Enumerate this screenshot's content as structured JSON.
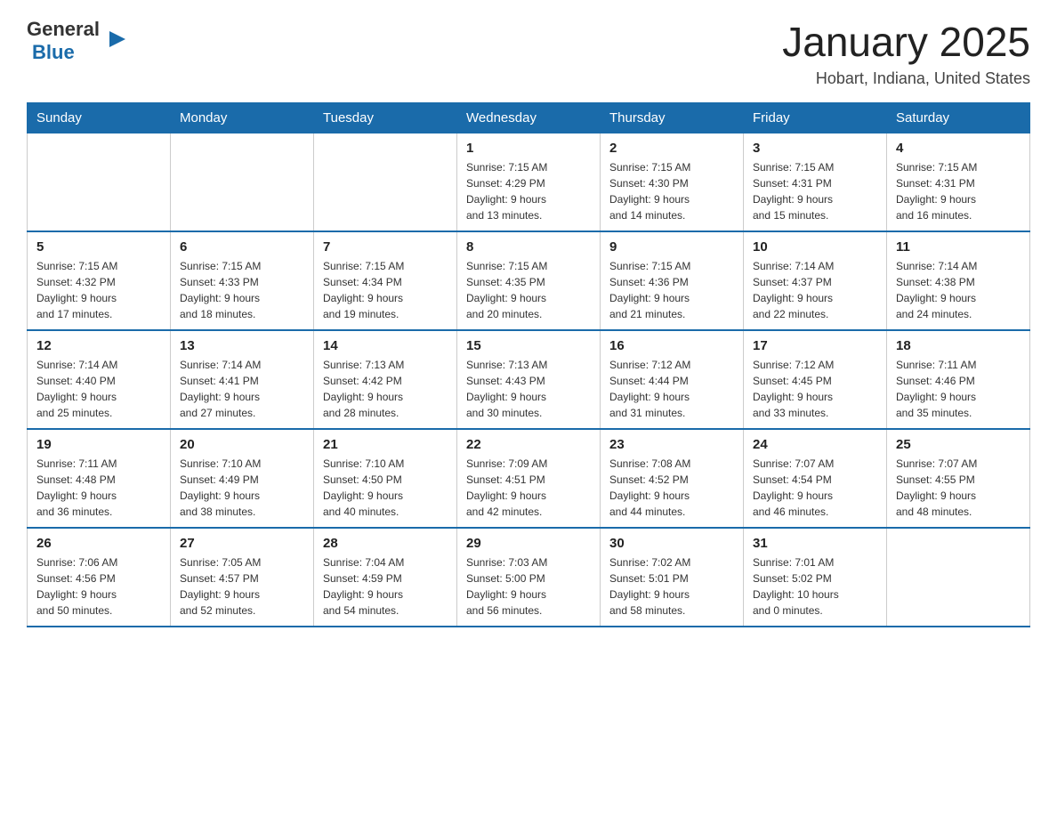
{
  "header": {
    "logo": {
      "general": "General",
      "blue": "Blue"
    },
    "title": "January 2025",
    "subtitle": "Hobart, Indiana, United States"
  },
  "weekdays": [
    "Sunday",
    "Monday",
    "Tuesday",
    "Wednesday",
    "Thursday",
    "Friday",
    "Saturday"
  ],
  "weeks": [
    [
      {
        "day": "",
        "info": ""
      },
      {
        "day": "",
        "info": ""
      },
      {
        "day": "",
        "info": ""
      },
      {
        "day": "1",
        "info": "Sunrise: 7:15 AM\nSunset: 4:29 PM\nDaylight: 9 hours\nand 13 minutes."
      },
      {
        "day": "2",
        "info": "Sunrise: 7:15 AM\nSunset: 4:30 PM\nDaylight: 9 hours\nand 14 minutes."
      },
      {
        "day": "3",
        "info": "Sunrise: 7:15 AM\nSunset: 4:31 PM\nDaylight: 9 hours\nand 15 minutes."
      },
      {
        "day": "4",
        "info": "Sunrise: 7:15 AM\nSunset: 4:31 PM\nDaylight: 9 hours\nand 16 minutes."
      }
    ],
    [
      {
        "day": "5",
        "info": "Sunrise: 7:15 AM\nSunset: 4:32 PM\nDaylight: 9 hours\nand 17 minutes."
      },
      {
        "day": "6",
        "info": "Sunrise: 7:15 AM\nSunset: 4:33 PM\nDaylight: 9 hours\nand 18 minutes."
      },
      {
        "day": "7",
        "info": "Sunrise: 7:15 AM\nSunset: 4:34 PM\nDaylight: 9 hours\nand 19 minutes."
      },
      {
        "day": "8",
        "info": "Sunrise: 7:15 AM\nSunset: 4:35 PM\nDaylight: 9 hours\nand 20 minutes."
      },
      {
        "day": "9",
        "info": "Sunrise: 7:15 AM\nSunset: 4:36 PM\nDaylight: 9 hours\nand 21 minutes."
      },
      {
        "day": "10",
        "info": "Sunrise: 7:14 AM\nSunset: 4:37 PM\nDaylight: 9 hours\nand 22 minutes."
      },
      {
        "day": "11",
        "info": "Sunrise: 7:14 AM\nSunset: 4:38 PM\nDaylight: 9 hours\nand 24 minutes."
      }
    ],
    [
      {
        "day": "12",
        "info": "Sunrise: 7:14 AM\nSunset: 4:40 PM\nDaylight: 9 hours\nand 25 minutes."
      },
      {
        "day": "13",
        "info": "Sunrise: 7:14 AM\nSunset: 4:41 PM\nDaylight: 9 hours\nand 27 minutes."
      },
      {
        "day": "14",
        "info": "Sunrise: 7:13 AM\nSunset: 4:42 PM\nDaylight: 9 hours\nand 28 minutes."
      },
      {
        "day": "15",
        "info": "Sunrise: 7:13 AM\nSunset: 4:43 PM\nDaylight: 9 hours\nand 30 minutes."
      },
      {
        "day": "16",
        "info": "Sunrise: 7:12 AM\nSunset: 4:44 PM\nDaylight: 9 hours\nand 31 minutes."
      },
      {
        "day": "17",
        "info": "Sunrise: 7:12 AM\nSunset: 4:45 PM\nDaylight: 9 hours\nand 33 minutes."
      },
      {
        "day": "18",
        "info": "Sunrise: 7:11 AM\nSunset: 4:46 PM\nDaylight: 9 hours\nand 35 minutes."
      }
    ],
    [
      {
        "day": "19",
        "info": "Sunrise: 7:11 AM\nSunset: 4:48 PM\nDaylight: 9 hours\nand 36 minutes."
      },
      {
        "day": "20",
        "info": "Sunrise: 7:10 AM\nSunset: 4:49 PM\nDaylight: 9 hours\nand 38 minutes."
      },
      {
        "day": "21",
        "info": "Sunrise: 7:10 AM\nSunset: 4:50 PM\nDaylight: 9 hours\nand 40 minutes."
      },
      {
        "day": "22",
        "info": "Sunrise: 7:09 AM\nSunset: 4:51 PM\nDaylight: 9 hours\nand 42 minutes."
      },
      {
        "day": "23",
        "info": "Sunrise: 7:08 AM\nSunset: 4:52 PM\nDaylight: 9 hours\nand 44 minutes."
      },
      {
        "day": "24",
        "info": "Sunrise: 7:07 AM\nSunset: 4:54 PM\nDaylight: 9 hours\nand 46 minutes."
      },
      {
        "day": "25",
        "info": "Sunrise: 7:07 AM\nSunset: 4:55 PM\nDaylight: 9 hours\nand 48 minutes."
      }
    ],
    [
      {
        "day": "26",
        "info": "Sunrise: 7:06 AM\nSunset: 4:56 PM\nDaylight: 9 hours\nand 50 minutes."
      },
      {
        "day": "27",
        "info": "Sunrise: 7:05 AM\nSunset: 4:57 PM\nDaylight: 9 hours\nand 52 minutes."
      },
      {
        "day": "28",
        "info": "Sunrise: 7:04 AM\nSunset: 4:59 PM\nDaylight: 9 hours\nand 54 minutes."
      },
      {
        "day": "29",
        "info": "Sunrise: 7:03 AM\nSunset: 5:00 PM\nDaylight: 9 hours\nand 56 minutes."
      },
      {
        "day": "30",
        "info": "Sunrise: 7:02 AM\nSunset: 5:01 PM\nDaylight: 9 hours\nand 58 minutes."
      },
      {
        "day": "31",
        "info": "Sunrise: 7:01 AM\nSunset: 5:02 PM\nDaylight: 10 hours\nand 0 minutes."
      },
      {
        "day": "",
        "info": ""
      }
    ]
  ]
}
